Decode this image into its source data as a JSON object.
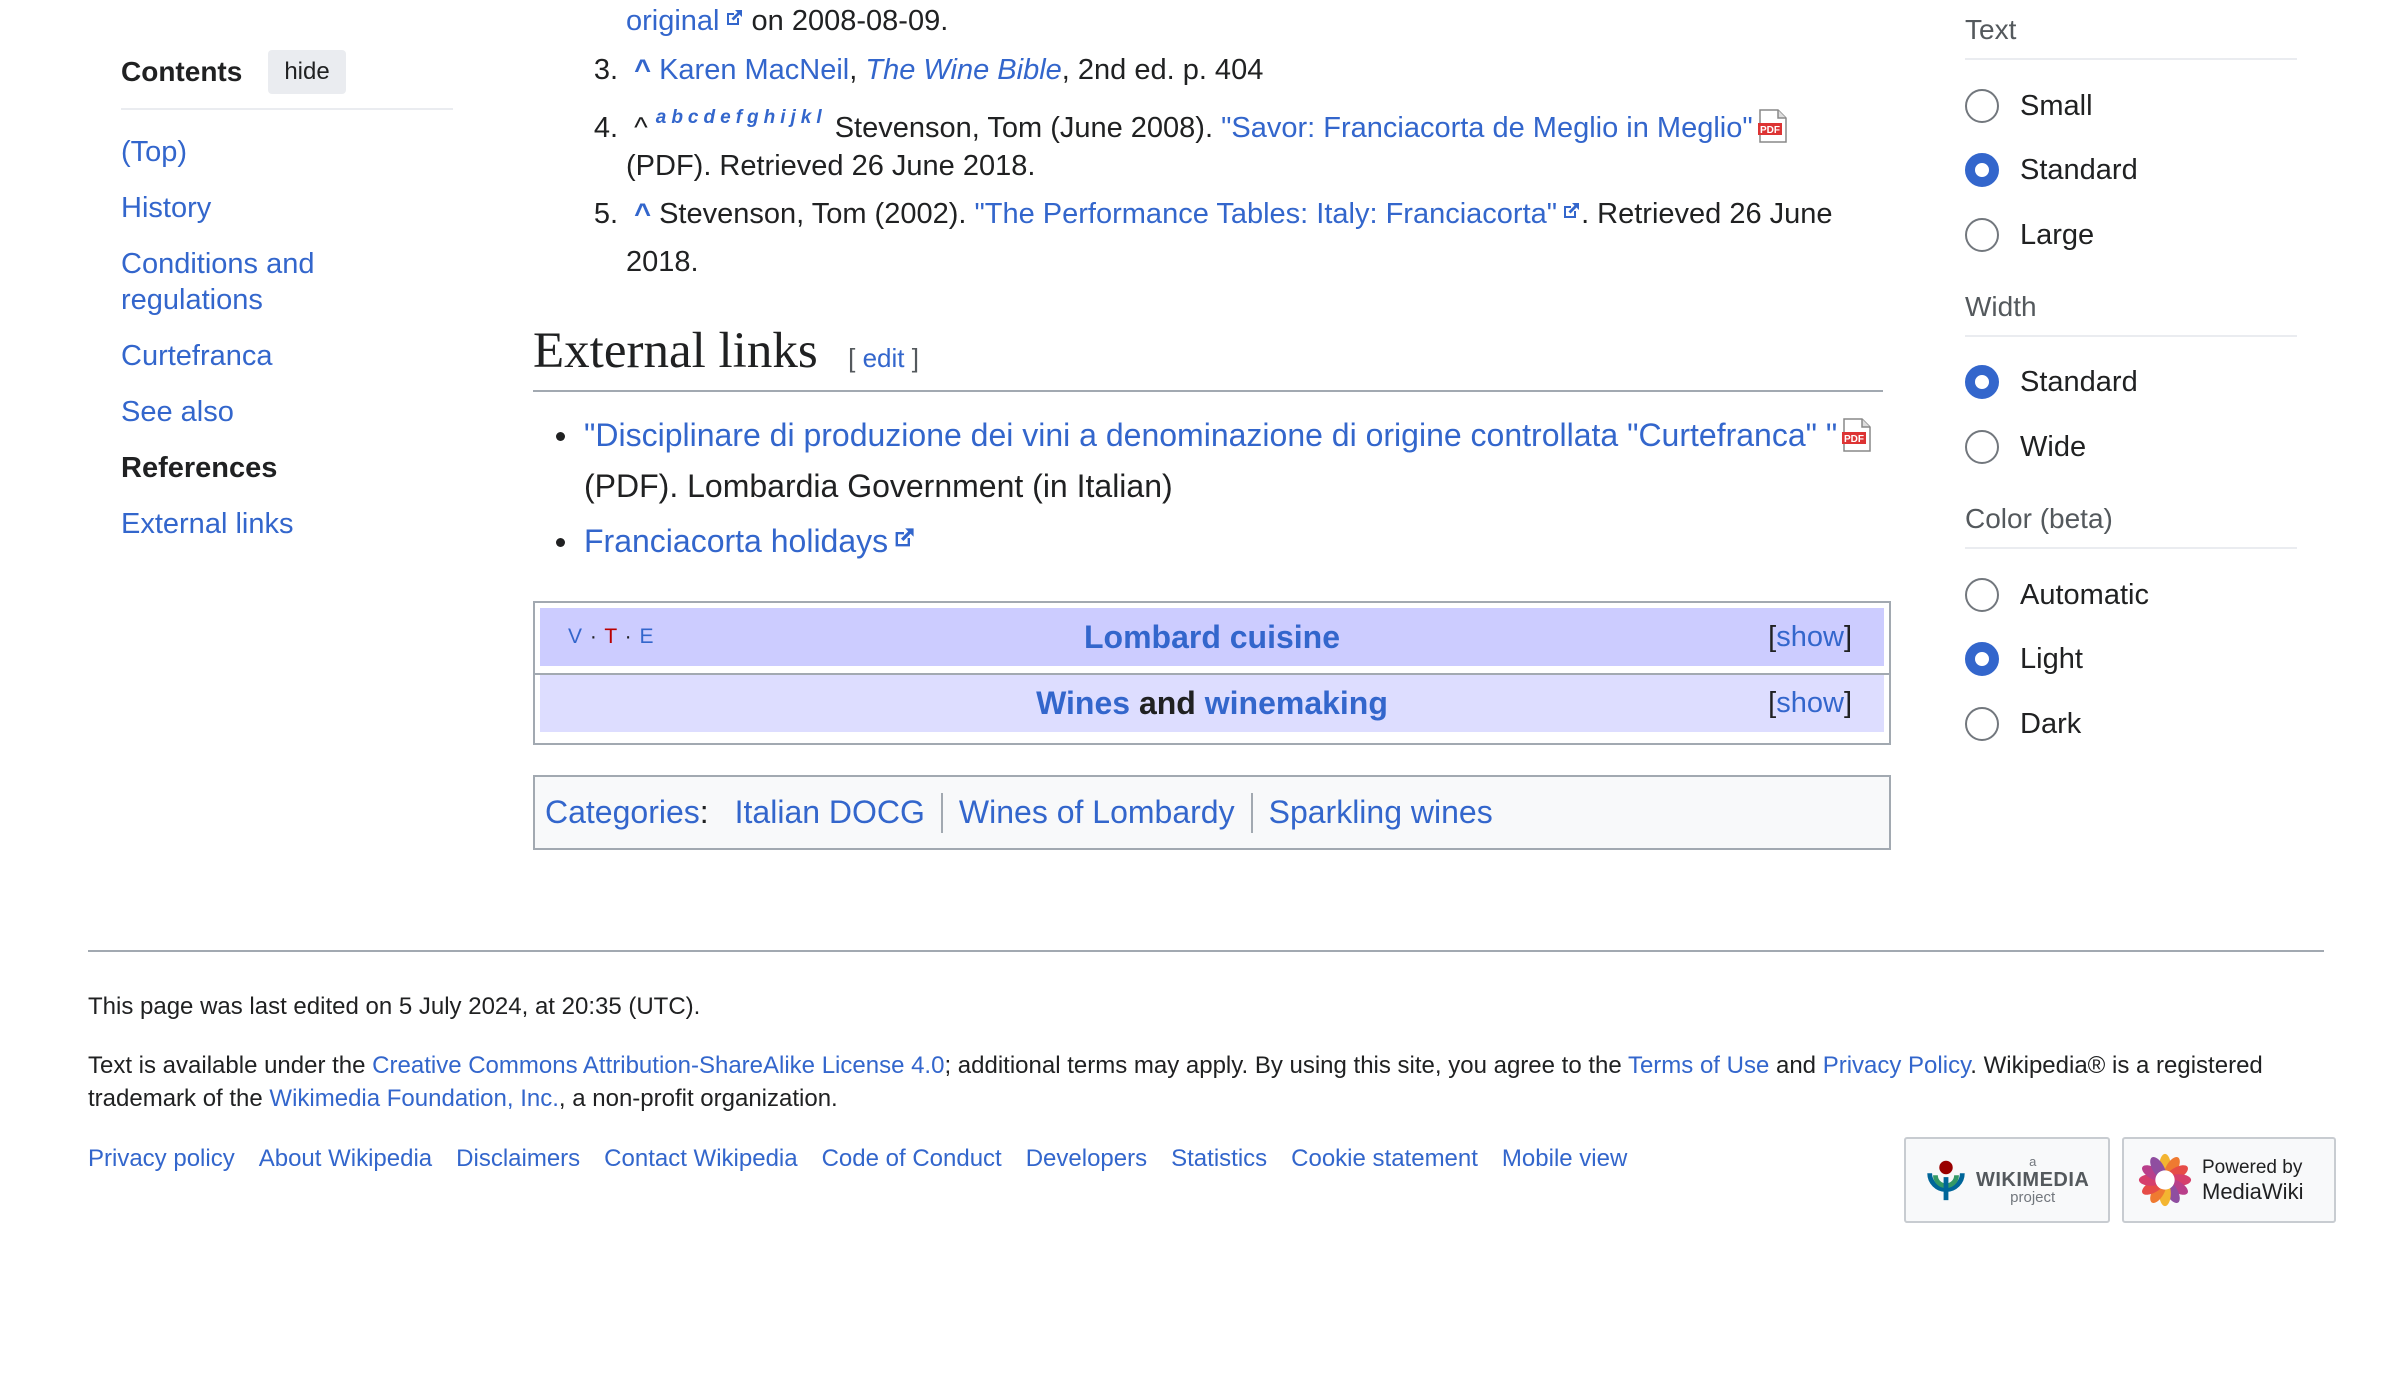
{
  "toc": {
    "title": "Contents",
    "hide_label": "hide",
    "items": [
      {
        "label": "(Top)"
      },
      {
        "label": "History"
      },
      {
        "label": "Conditions and regulations"
      },
      {
        "label": "Curtefranca"
      },
      {
        "label": "See also"
      },
      {
        "label": "References"
      },
      {
        "label": "External links"
      }
    ]
  },
  "references": {
    "top_line": {
      "link": "original",
      "text": " on 2008-08-09."
    },
    "ref3": {
      "num": "3.",
      "caret": "^",
      "author": "Karen MacNeil",
      "sep": ", ",
      "book": "The Wine Bible",
      "rest": ", 2nd ed. p. 404"
    },
    "ref4": {
      "num": "4.",
      "caret": "^",
      "backlinks": [
        "a",
        "b",
        "c",
        "d",
        "e",
        "f",
        "g",
        "h",
        "i",
        "j",
        "k",
        "l"
      ],
      "author": "Stevenson, Tom (June 2008). ",
      "title": "\"Savor: Franciacorta de Meglio in Meglio\"",
      "rest": "(PDF). Retrieved 26 June 2018."
    },
    "ref5": {
      "num": "5.",
      "caret": "^",
      "author": "Stevenson, Tom (2002). ",
      "title": "\"The Performance Tables: Italy: Franciacorta\"",
      "rest1": ". Retrieved 26 June",
      "rest2": "2018."
    }
  },
  "external_links": {
    "heading": "External links",
    "edit_open": "[ ",
    "edit_label": "edit",
    "edit_close": " ]",
    "items": [
      {
        "link": "\"Disciplinare di produzione dei vini a denominazione di origine controllata \"Curtefranca\" \"",
        "rest": "(PDF). Lombardia Government (in Italian)"
      },
      {
        "link": "Franciacorta holidays"
      }
    ]
  },
  "navboxes": [
    {
      "title": "Lombard cuisine",
      "vte": [
        "V",
        "T",
        "E"
      ],
      "show_open": "[",
      "show_label": "show",
      "show_close": "]"
    },
    {
      "title_link1": "Wines",
      "title_mid": " and ",
      "title_link2": "winemaking",
      "show_open": "[",
      "show_label": "show",
      "show_close": "]"
    }
  ],
  "categories": {
    "label": "Categories",
    "colon": ":",
    "items": [
      "Italian DOCG",
      "Wines of Lombardy",
      "Sparkling wines"
    ]
  },
  "appearance": {
    "text": {
      "heading": "Text",
      "options": [
        "Small",
        "Standard",
        "Large"
      ],
      "selected": "Standard"
    },
    "width": {
      "heading": "Width",
      "options": [
        "Standard",
        "Wide"
      ],
      "selected": "Standard"
    },
    "color": {
      "heading": "Color (beta)",
      "options": [
        "Automatic",
        "Light",
        "Dark"
      ],
      "selected": "Light"
    }
  },
  "footer": {
    "last_edited": "This page was last edited on 5 July 2024, at 20:35 (UTC).",
    "license_pre": "Text is available under the ",
    "license_link": "Creative Commons Attribution-ShareAlike License 4.0",
    "license_mid": "; additional terms may apply. By using this site, you agree to the ",
    "terms_link": "Terms of Use",
    "and": " and ",
    "privacy_link": "Privacy Policy",
    "license_post": ". Wikipedia® is a registered",
    "line2_pre": "trademark of the ",
    "foundation_link": "Wikimedia Foundation, Inc.",
    "line2_post": ", a non-profit organization.",
    "places": [
      "Privacy policy",
      "About Wikipedia",
      "Disclaimers",
      "Contact Wikipedia",
      "Code of Conduct",
      "Developers",
      "Statistics",
      "Cookie statement",
      "Mobile view"
    ],
    "wikimedia_badge": {
      "small": "a",
      "name": "WIKIMEDIA",
      "sub": "project"
    },
    "mediawiki_badge": {
      "line1": "Powered by",
      "line2": "MediaWiki"
    }
  },
  "colors": {
    "link": "#3366cc",
    "navbox_title_bg": "#ccccff",
    "navbox_group_bg": "#ddddff",
    "radio_on": "#3366cc"
  }
}
